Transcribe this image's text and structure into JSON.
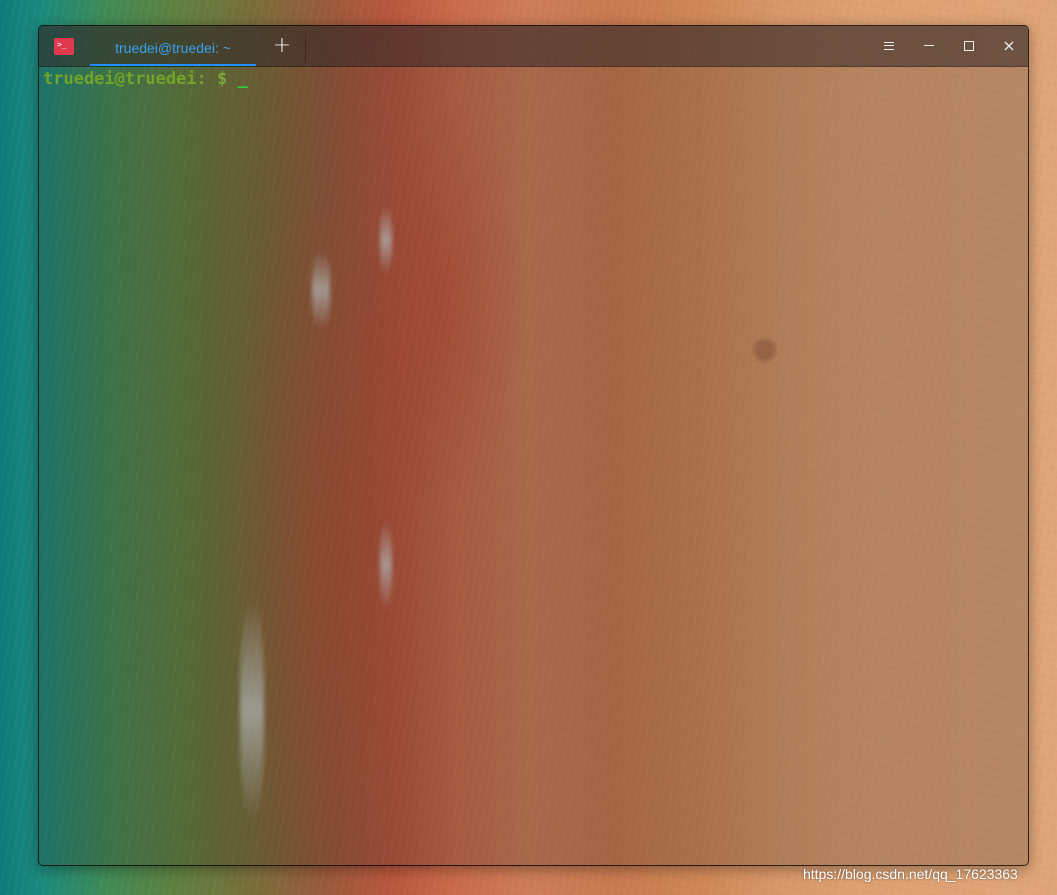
{
  "desktop": {
    "wallpaper": "aerial-beach-wallpaper"
  },
  "window": {
    "app_icon": "terminal-icon",
    "tabs": [
      {
        "label": "truedei@truedei: ~",
        "active": true
      }
    ],
    "new_tab_symbol": "+",
    "controls": {
      "menu_icon": "hamburger-menu-icon",
      "minimize_icon": "minimize-icon",
      "maximize_icon": "maximize-icon",
      "close_symbol": "×"
    }
  },
  "terminal": {
    "prompt_user_host": "truedei@truedei",
    "prompt_colon": ":",
    "prompt_path": " ",
    "prompt_dollar": "$ ",
    "cursor": "_",
    "colors": {
      "user_host": "#73a428",
      "cursor": "#2fd040",
      "tab_accent": "#1e90ff",
      "app_icon_bg": "#e0394d"
    }
  },
  "watermark": "https://blog.csdn.net/qq_17623363"
}
